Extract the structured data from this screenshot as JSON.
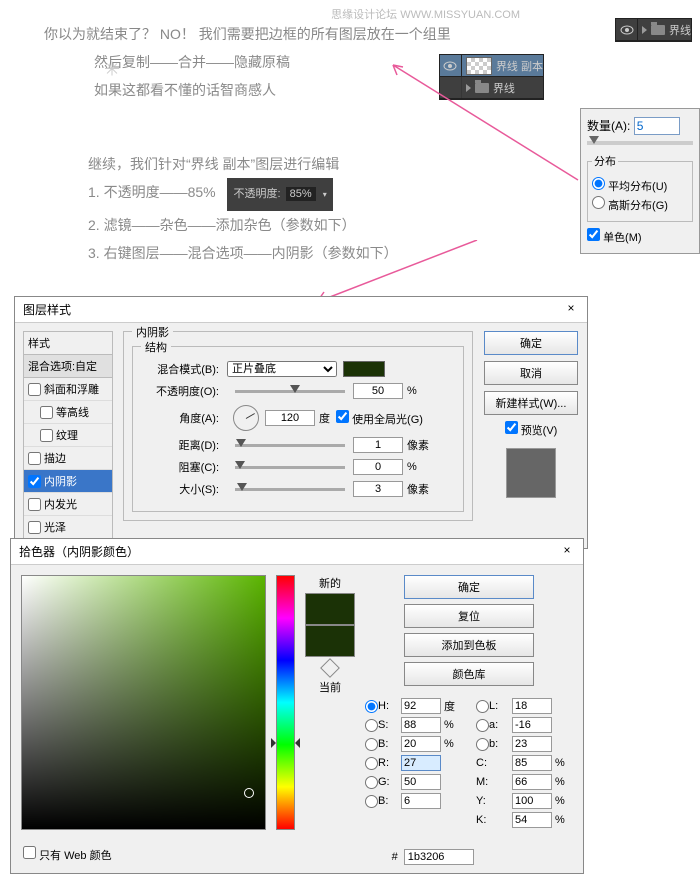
{
  "watermark": "思缘设计论坛  WWW.MISSYUAN.COM",
  "intro": {
    "l1": "你以为就结束了？ NO！ 我们需要把边框的所有图层放在一个组里",
    "l2": "然后复制——合并——隐藏原稿",
    "l3": "如果这都看不懂的话智商感人"
  },
  "layers_top": {
    "group": "界线"
  },
  "layers_panel": {
    "copy": "界线 副本",
    "group": "界线"
  },
  "body2": {
    "l0": "继续，我们针对“界线 副本”图层进行编辑",
    "l1": "1. 不透明度——85%",
    "opacity_label": "不透明度:",
    "opacity_val": "85%",
    "l2": "2. 滤镜——杂色——添加杂色（参数如下）",
    "l3": "3. 右键图层——混合选项——内阴影（参数如下）"
  },
  "noise": {
    "qty_label": "数量(A):",
    "qty_val": "5",
    "dist_legend": "分布",
    "uniform": "平均分布(U)",
    "gaussian": "高斯分布(G)",
    "mono": "单色(M)"
  },
  "ls": {
    "title": "图层样式",
    "close": "×",
    "left_hd": "样式",
    "left_sub": "混合选项:自定",
    "items": [
      "斜面和浮雕",
      "等高线",
      "纹理",
      "描边",
      "内阴影",
      "内发光",
      "光泽"
    ],
    "section": "内阴影",
    "struct": "结构",
    "blend_label": "混合模式(B):",
    "blend_val": "正片叠底",
    "opacity_label": "不透明度(O):",
    "opacity_val": "50",
    "pct": "%",
    "angle_label": "角度(A):",
    "angle_val": "120",
    "deg": "度",
    "global": "使用全局光(G)",
    "dist_label": "距离(D):",
    "dist_val": "1",
    "px": "像素",
    "choke_label": "阻塞(C):",
    "choke_val": "0",
    "size_label": "大小(S):",
    "size_val": "3",
    "ok": "确定",
    "cancel": "取消",
    "newstyle": "新建样式(W)...",
    "preview": "预览(V)"
  },
  "cp": {
    "title": "拾色器（内阴影颜色）",
    "close": "×",
    "new": "新的",
    "cur": "当前",
    "ok": "确定",
    "reset": "复位",
    "add": "添加到色板",
    "lib": "颜色库",
    "H": "H:",
    "Hv": "92",
    "Hu": "度",
    "S": "S:",
    "Sv": "88",
    "Su": "%",
    "Bb": "B:",
    "Bv": "20",
    "Bu": "%",
    "R": "R:",
    "Rv": "27",
    "G": "G:",
    "Gv": "50",
    "Bc": "B:",
    "Bcv": "6",
    "L": "L:",
    "Lv": "18",
    "a": "a:",
    "av": "-16",
    "b": "b:",
    "bv": "23",
    "C": "C:",
    "Cv": "85",
    "Cu": "%",
    "M": "M:",
    "Mv": "66",
    "Mu": "%",
    "Y": "Y:",
    "Yv": "100",
    "Yu": "%",
    "K": "K:",
    "Kv": "54",
    "Ku": "%",
    "hex_label": "#",
    "hex": "1b3206",
    "webonly": "只有 Web 颜色"
  }
}
